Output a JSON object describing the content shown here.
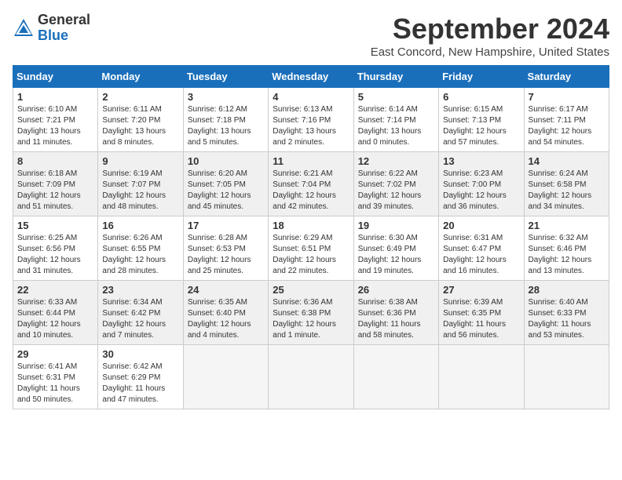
{
  "header": {
    "logo_general": "General",
    "logo_blue": "Blue",
    "month_title": "September 2024",
    "location": "East Concord, New Hampshire, United States"
  },
  "days_of_week": [
    "Sunday",
    "Monday",
    "Tuesday",
    "Wednesday",
    "Thursday",
    "Friday",
    "Saturday"
  ],
  "weeks": [
    [
      {
        "day": "1",
        "sunrise": "Sunrise: 6:10 AM",
        "sunset": "Sunset: 7:21 PM",
        "daylight": "Daylight: 13 hours and 11 minutes."
      },
      {
        "day": "2",
        "sunrise": "Sunrise: 6:11 AM",
        "sunset": "Sunset: 7:20 PM",
        "daylight": "Daylight: 13 hours and 8 minutes."
      },
      {
        "day": "3",
        "sunrise": "Sunrise: 6:12 AM",
        "sunset": "Sunset: 7:18 PM",
        "daylight": "Daylight: 13 hours and 5 minutes."
      },
      {
        "day": "4",
        "sunrise": "Sunrise: 6:13 AM",
        "sunset": "Sunset: 7:16 PM",
        "daylight": "Daylight: 13 hours and 2 minutes."
      },
      {
        "day": "5",
        "sunrise": "Sunrise: 6:14 AM",
        "sunset": "Sunset: 7:14 PM",
        "daylight": "Daylight: 13 hours and 0 minutes."
      },
      {
        "day": "6",
        "sunrise": "Sunrise: 6:15 AM",
        "sunset": "Sunset: 7:13 PM",
        "daylight": "Daylight: 12 hours and 57 minutes."
      },
      {
        "day": "7",
        "sunrise": "Sunrise: 6:17 AM",
        "sunset": "Sunset: 7:11 PM",
        "daylight": "Daylight: 12 hours and 54 minutes."
      }
    ],
    [
      {
        "day": "8",
        "sunrise": "Sunrise: 6:18 AM",
        "sunset": "Sunset: 7:09 PM",
        "daylight": "Daylight: 12 hours and 51 minutes."
      },
      {
        "day": "9",
        "sunrise": "Sunrise: 6:19 AM",
        "sunset": "Sunset: 7:07 PM",
        "daylight": "Daylight: 12 hours and 48 minutes."
      },
      {
        "day": "10",
        "sunrise": "Sunrise: 6:20 AM",
        "sunset": "Sunset: 7:05 PM",
        "daylight": "Daylight: 12 hours and 45 minutes."
      },
      {
        "day": "11",
        "sunrise": "Sunrise: 6:21 AM",
        "sunset": "Sunset: 7:04 PM",
        "daylight": "Daylight: 12 hours and 42 minutes."
      },
      {
        "day": "12",
        "sunrise": "Sunrise: 6:22 AM",
        "sunset": "Sunset: 7:02 PM",
        "daylight": "Daylight: 12 hours and 39 minutes."
      },
      {
        "day": "13",
        "sunrise": "Sunrise: 6:23 AM",
        "sunset": "Sunset: 7:00 PM",
        "daylight": "Daylight: 12 hours and 36 minutes."
      },
      {
        "day": "14",
        "sunrise": "Sunrise: 6:24 AM",
        "sunset": "Sunset: 6:58 PM",
        "daylight": "Daylight: 12 hours and 34 minutes."
      }
    ],
    [
      {
        "day": "15",
        "sunrise": "Sunrise: 6:25 AM",
        "sunset": "Sunset: 6:56 PM",
        "daylight": "Daylight: 12 hours and 31 minutes."
      },
      {
        "day": "16",
        "sunrise": "Sunrise: 6:26 AM",
        "sunset": "Sunset: 6:55 PM",
        "daylight": "Daylight: 12 hours and 28 minutes."
      },
      {
        "day": "17",
        "sunrise": "Sunrise: 6:28 AM",
        "sunset": "Sunset: 6:53 PM",
        "daylight": "Daylight: 12 hours and 25 minutes."
      },
      {
        "day": "18",
        "sunrise": "Sunrise: 6:29 AM",
        "sunset": "Sunset: 6:51 PM",
        "daylight": "Daylight: 12 hours and 22 minutes."
      },
      {
        "day": "19",
        "sunrise": "Sunrise: 6:30 AM",
        "sunset": "Sunset: 6:49 PM",
        "daylight": "Daylight: 12 hours and 19 minutes."
      },
      {
        "day": "20",
        "sunrise": "Sunrise: 6:31 AM",
        "sunset": "Sunset: 6:47 PM",
        "daylight": "Daylight: 12 hours and 16 minutes."
      },
      {
        "day": "21",
        "sunrise": "Sunrise: 6:32 AM",
        "sunset": "Sunset: 6:46 PM",
        "daylight": "Daylight: 12 hours and 13 minutes."
      }
    ],
    [
      {
        "day": "22",
        "sunrise": "Sunrise: 6:33 AM",
        "sunset": "Sunset: 6:44 PM",
        "daylight": "Daylight: 12 hours and 10 minutes."
      },
      {
        "day": "23",
        "sunrise": "Sunrise: 6:34 AM",
        "sunset": "Sunset: 6:42 PM",
        "daylight": "Daylight: 12 hours and 7 minutes."
      },
      {
        "day": "24",
        "sunrise": "Sunrise: 6:35 AM",
        "sunset": "Sunset: 6:40 PM",
        "daylight": "Daylight: 12 hours and 4 minutes."
      },
      {
        "day": "25",
        "sunrise": "Sunrise: 6:36 AM",
        "sunset": "Sunset: 6:38 PM",
        "daylight": "Daylight: 12 hours and 1 minute."
      },
      {
        "day": "26",
        "sunrise": "Sunrise: 6:38 AM",
        "sunset": "Sunset: 6:36 PM",
        "daylight": "Daylight: 11 hours and 58 minutes."
      },
      {
        "day": "27",
        "sunrise": "Sunrise: 6:39 AM",
        "sunset": "Sunset: 6:35 PM",
        "daylight": "Daylight: 11 hours and 56 minutes."
      },
      {
        "day": "28",
        "sunrise": "Sunrise: 6:40 AM",
        "sunset": "Sunset: 6:33 PM",
        "daylight": "Daylight: 11 hours and 53 minutes."
      }
    ],
    [
      {
        "day": "29",
        "sunrise": "Sunrise: 6:41 AM",
        "sunset": "Sunset: 6:31 PM",
        "daylight": "Daylight: 11 hours and 50 minutes."
      },
      {
        "day": "30",
        "sunrise": "Sunrise: 6:42 AM",
        "sunset": "Sunset: 6:29 PM",
        "daylight": "Daylight: 11 hours and 47 minutes."
      },
      null,
      null,
      null,
      null,
      null
    ]
  ]
}
